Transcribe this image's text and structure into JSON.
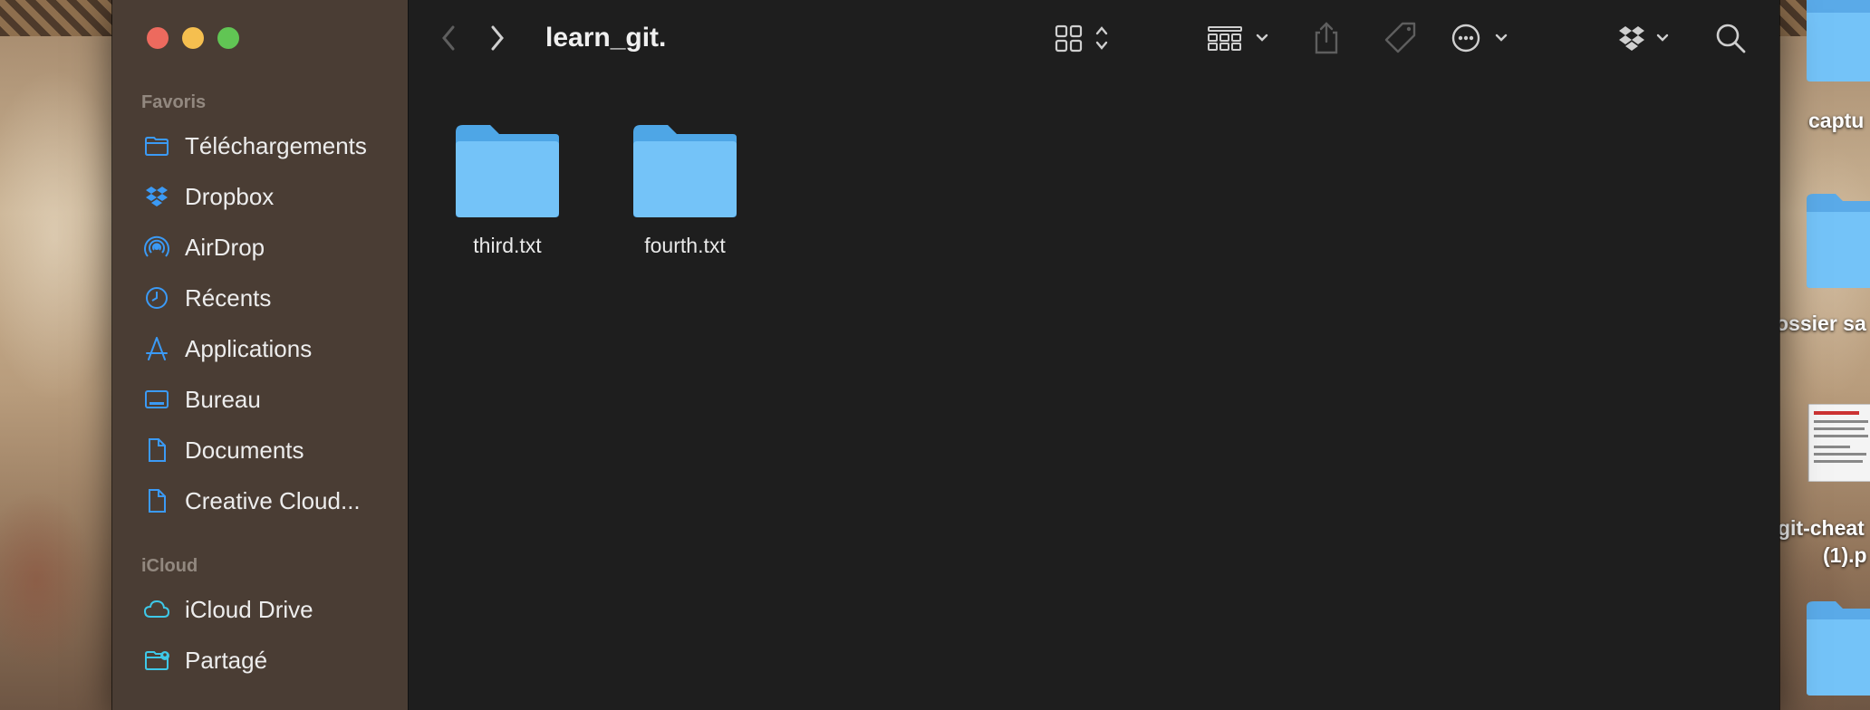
{
  "window": {
    "title": "learn_git."
  },
  "toolbar": {
    "back": "chevron-left-icon",
    "forward": "chevron-right-icon",
    "view": "grid-view-icon",
    "group": "group-icon",
    "share": "share-icon",
    "tags": "tag-icon",
    "more": "ellipsis-circle-icon",
    "dropbox": "dropbox-icon",
    "search": "search-icon"
  },
  "sidebar": {
    "favorites_title": "Favoris",
    "icloud_title": "iCloud",
    "favorites": [
      {
        "label": "Téléchargements",
        "icon": "folder-icon"
      },
      {
        "label": "Dropbox",
        "icon": "dropbox-icon"
      },
      {
        "label": "AirDrop",
        "icon": "airdrop-icon"
      },
      {
        "label": "Récents",
        "icon": "clock-icon"
      },
      {
        "label": "Applications",
        "icon": "applications-icon"
      },
      {
        "label": "Bureau",
        "icon": "desktop-icon"
      },
      {
        "label": "Documents",
        "icon": "document-icon"
      },
      {
        "label": "Creative Cloud...",
        "icon": "document-icon"
      }
    ],
    "icloud": [
      {
        "label": "iCloud Drive",
        "icon": "cloud-icon"
      },
      {
        "label": "Partagé",
        "icon": "shared-folder-icon"
      }
    ]
  },
  "files": [
    {
      "name": "third.txt"
    },
    {
      "name": "fourth.txt"
    }
  ],
  "desktop": [
    {
      "label": "captu"
    },
    {
      "label": "ossier sa"
    },
    {
      "label_line1": "git-cheat",
      "label_line2": "(1).p"
    }
  ],
  "colors": {
    "accent": "#3b9af5",
    "folder": "#6fbdf2",
    "close": "#ed6a5e",
    "minimize": "#f5bf4f",
    "zoom": "#61c554"
  }
}
